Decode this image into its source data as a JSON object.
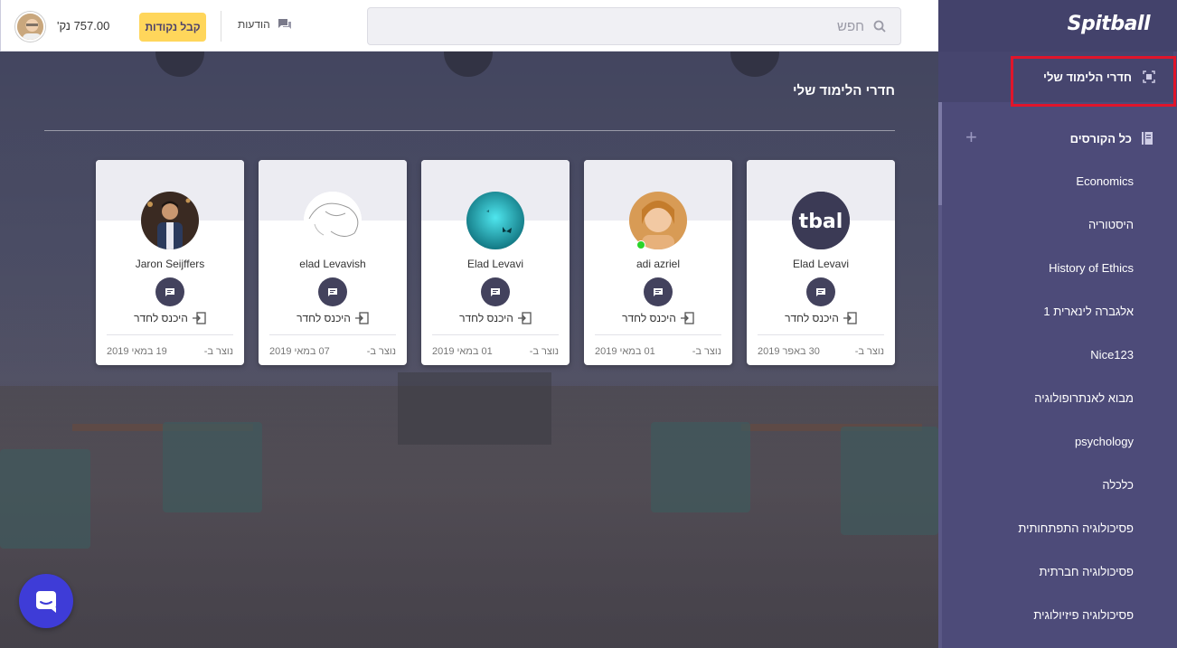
{
  "topbar": {
    "balance": "757.00 נק'",
    "get_points_label": "קבל נקודות",
    "messages_label": "הודעות",
    "search_placeholder": "חפש"
  },
  "main": {
    "heading": "חדרי הלימוד שלי",
    "rooms": [
      {
        "name": "Elad Levavi",
        "enter_label": "היכנס לחדר",
        "created_label": "נוצר ב-",
        "date": "30 באפר 2019",
        "online": false
      },
      {
        "name": "adi azriel",
        "enter_label": "היכנס לחדר",
        "created_label": "נוצר ב-",
        "date": "01 במאי 2019",
        "online": true
      },
      {
        "name": "Elad Levavi",
        "enter_label": "היכנס לחדר",
        "created_label": "נוצר ב-",
        "date": "01 במאי 2019",
        "online": false
      },
      {
        "name": "elad Levavish",
        "enter_label": "היכנס לחדר",
        "created_label": "נוצר ב-",
        "date": "07 במאי 2019",
        "online": false
      },
      {
        "name": "Jaron Seijffers",
        "enter_label": "היכנס לחדר",
        "created_label": "נוצר ב-",
        "date": "19 במאי 2019",
        "online": false
      }
    ],
    "first_card_logo_text": "tbal"
  },
  "sidebar": {
    "logo": "Spitball",
    "my_rooms_label": "חדרי הלימוד שלי",
    "all_courses_label": "כל הקורסים",
    "courses": [
      "Economics",
      "היסטוריה",
      "History of Ethics",
      "אלגברה לינארית 1",
      "Nice123",
      "מבוא לאנתרופולוגיה",
      "psychology",
      "כלכלה",
      "פסיכולוגיה התפתחותית",
      "פסיכולוגיה חברתית",
      "פסיכולוגיה פיזיולוגית"
    ]
  },
  "colors": {
    "sidebar_bg": "#4d4b79",
    "accent_yellow": "#ffd65b",
    "chat_button": "#43425d",
    "highlight_red": "#e0152b",
    "intercom_blue": "#3e3cd7",
    "online_green": "#2ad42a"
  }
}
